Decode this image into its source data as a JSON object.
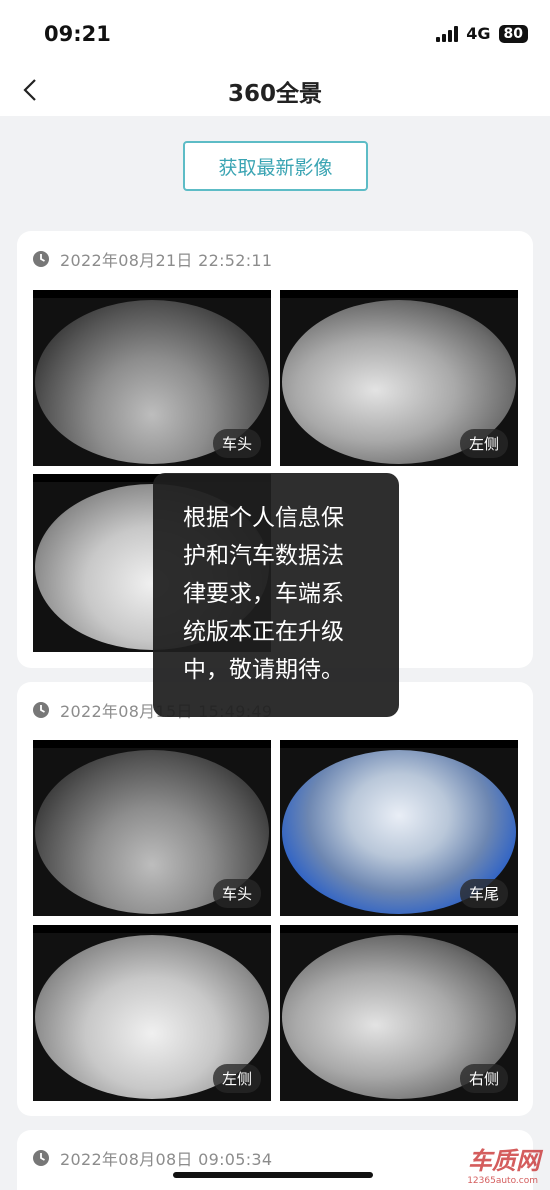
{
  "status_bar": {
    "time": "09:21",
    "network": "4G",
    "battery": "80"
  },
  "nav": {
    "title": "360全景"
  },
  "fetch_button": {
    "label": "获取最新影像"
  },
  "cards": [
    {
      "timestamp": "2022年08月21日 22:52:11",
      "photos": [
        {
          "label": "车头"
        },
        {
          "label": "左侧"
        },
        {
          "label": ""
        }
      ]
    },
    {
      "timestamp": "2022年08月15日 15:49:49",
      "photos": [
        {
          "label": "车头"
        },
        {
          "label": "车尾"
        },
        {
          "label": "左侧"
        },
        {
          "label": "右侧"
        }
      ]
    },
    {
      "timestamp": "2022年08月08日 09:05:34",
      "photos": []
    }
  ],
  "toast": {
    "lines": [
      "根据个人信息保",
      "护和汽车数据法",
      "律要求，车端系",
      "统版本正在升级",
      "中，敬请期待。"
    ]
  },
  "watermark": {
    "brand": "车质网",
    "url": "12365auto.com"
  }
}
